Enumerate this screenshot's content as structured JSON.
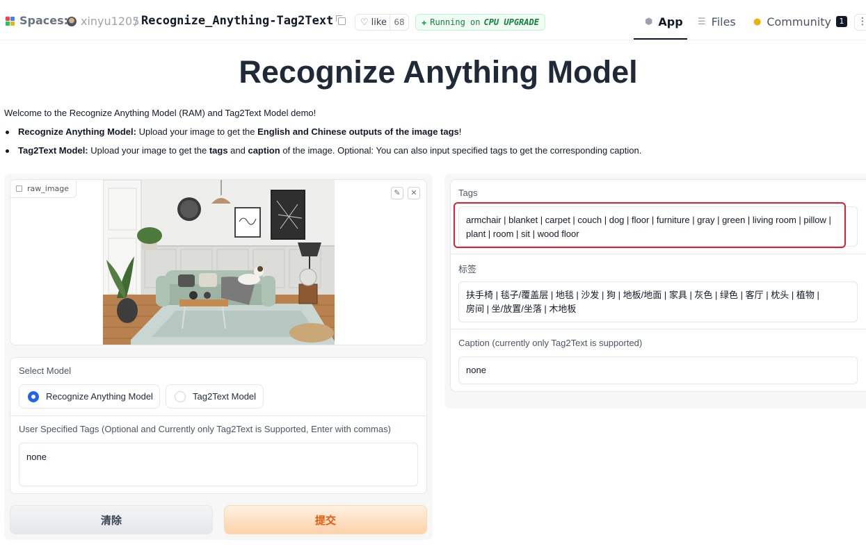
{
  "header": {
    "spaces_label": "Spaces:",
    "owner": "xinyu1205",
    "separator": "/",
    "repo": "Recognize_Anything-Tag2Text",
    "like_label": "like",
    "like_count": "68",
    "status_prefix": "Running on",
    "status_hw": "CPU UPGRADE",
    "nav": {
      "app": "App",
      "files": "Files",
      "community": "Community",
      "community_badge": "1"
    },
    "more": "⋮"
  },
  "page": {
    "title": "Recognize Anything Model",
    "intro": "Welcome to the Recognize Anything Model (RAM) and Tag2Text Model demo!",
    "bullets": [
      {
        "bold": "Recognize Anything Model:",
        "text1": " Upload your image to get the ",
        "bold2": "English and Chinese outputs of the image tags",
        "text2": "!"
      },
      {
        "bold": "Tag2Text Model:",
        "text1": " Upload your image to get the ",
        "bold2": "tags",
        "text2": " and ",
        "bold3": "caption",
        "text3": " of the image. Optional: You can also input specified tags to get the corresponding caption."
      }
    ]
  },
  "input": {
    "image_label": "raw_image",
    "edit_icon": "✎",
    "close_icon": "✕",
    "select_model_label": "Select Model",
    "models": [
      "Recognize Anything Model",
      "Tag2Text Model"
    ],
    "selected_model": "Recognize Anything Model",
    "tags_label": "User Specified Tags (Optional and Currently only Tag2Text is Supported, Enter with commas)",
    "tags_value": "none",
    "clear_button": "清除",
    "submit_button": "提交"
  },
  "output": {
    "tags_label": "Tags",
    "tags_line1": "armchair | blanket | carpet | couch | dog | floor | furniture | gray | green | living room | pillow |",
    "tags_line2": "plant | room | sit | wood floor",
    "cn_label": "标签",
    "cn_line1": "扶手椅 | 毯子/覆盖层 | 地毯 | 沙发 | 狗 | 地板/地面 | 家具 | 灰色 | 绿色 | 客厅 | 枕头 | 植物 |",
    "cn_line2": "房间 | 坐/放置/坐落 | 木地板",
    "caption_label": "Caption (currently only Tag2Text is supported)",
    "caption_value": "none"
  },
  "colors": {
    "accent_blue": "#2563eb",
    "submit_orange": "#ea580c",
    "highlight_red": "#e11d2e",
    "running_green": "#15803d"
  }
}
